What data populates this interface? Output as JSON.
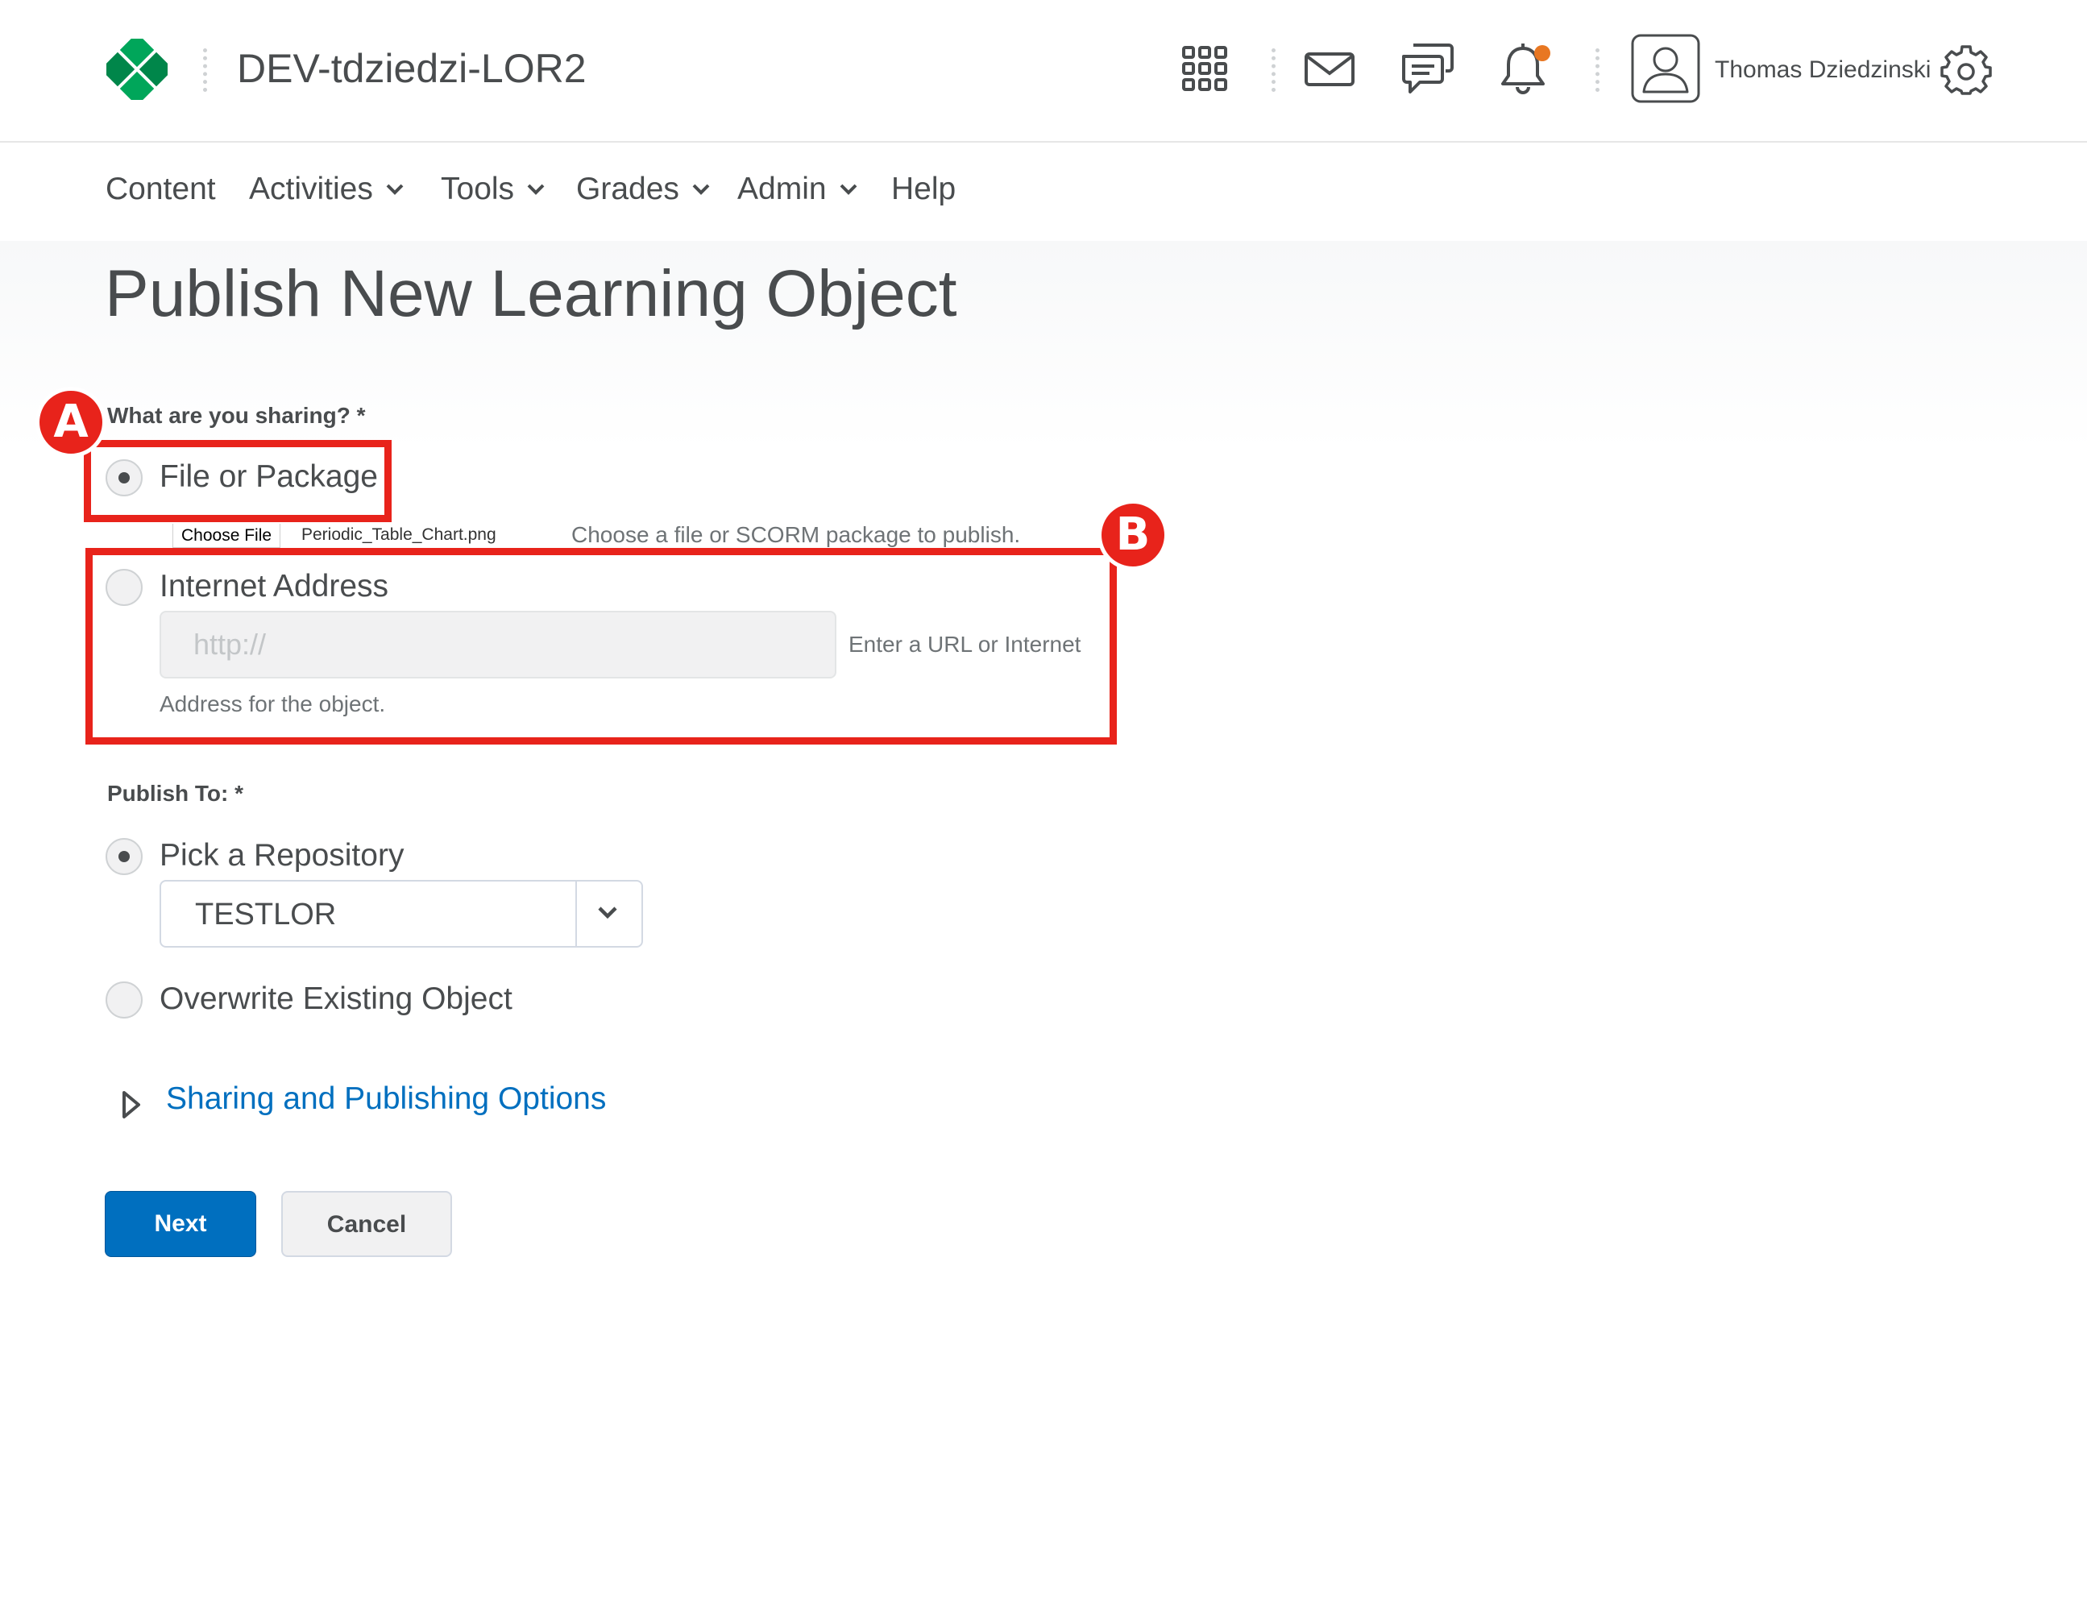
{
  "header": {
    "org_title": "DEV-tdziedzi-LOR2",
    "user_name": "Thomas Dziedzinski",
    "icons": [
      "brand-logo",
      "waffle-grid-icon",
      "email-icon",
      "chat-icon",
      "bell-icon",
      "avatar-icon",
      "gear-icon"
    ],
    "notification_color": "#e87722",
    "brand_color": "#009b4f"
  },
  "nav": {
    "items": [
      {
        "label": "Content",
        "dropdown": false
      },
      {
        "label": "Activities",
        "dropdown": true
      },
      {
        "label": "Tools",
        "dropdown": true
      },
      {
        "label": "Grades",
        "dropdown": true
      },
      {
        "label": "Admin",
        "dropdown": true
      },
      {
        "label": "Help",
        "dropdown": false
      }
    ]
  },
  "page": {
    "title": "Publish New Learning Object"
  },
  "sharing": {
    "label": "What are you sharing? *",
    "option_file": "File or Package",
    "option_file_selected": true,
    "choose_file_label": "Choose File",
    "file_name": "Periodic_Table_Chart.png",
    "file_help": "Choose a file or SCORM package to publish.",
    "option_url": "Internet Address",
    "option_url_selected": false,
    "url_placeholder": "http://",
    "url_help_line1": "Enter a URL or Internet",
    "url_help_line2": "Address for the object."
  },
  "publish_to": {
    "label": "Publish To: *",
    "option_repo": "Pick a Repository",
    "option_repo_selected": true,
    "repository_selected": "TESTLOR",
    "option_overwrite": "Overwrite Existing Object",
    "option_overwrite_selected": false
  },
  "options_link": "Sharing and Publishing Options",
  "buttons": {
    "next": "Next",
    "cancel": "Cancel"
  },
  "annotations": {
    "a": "A",
    "b": "B",
    "color": "#e8231b"
  }
}
